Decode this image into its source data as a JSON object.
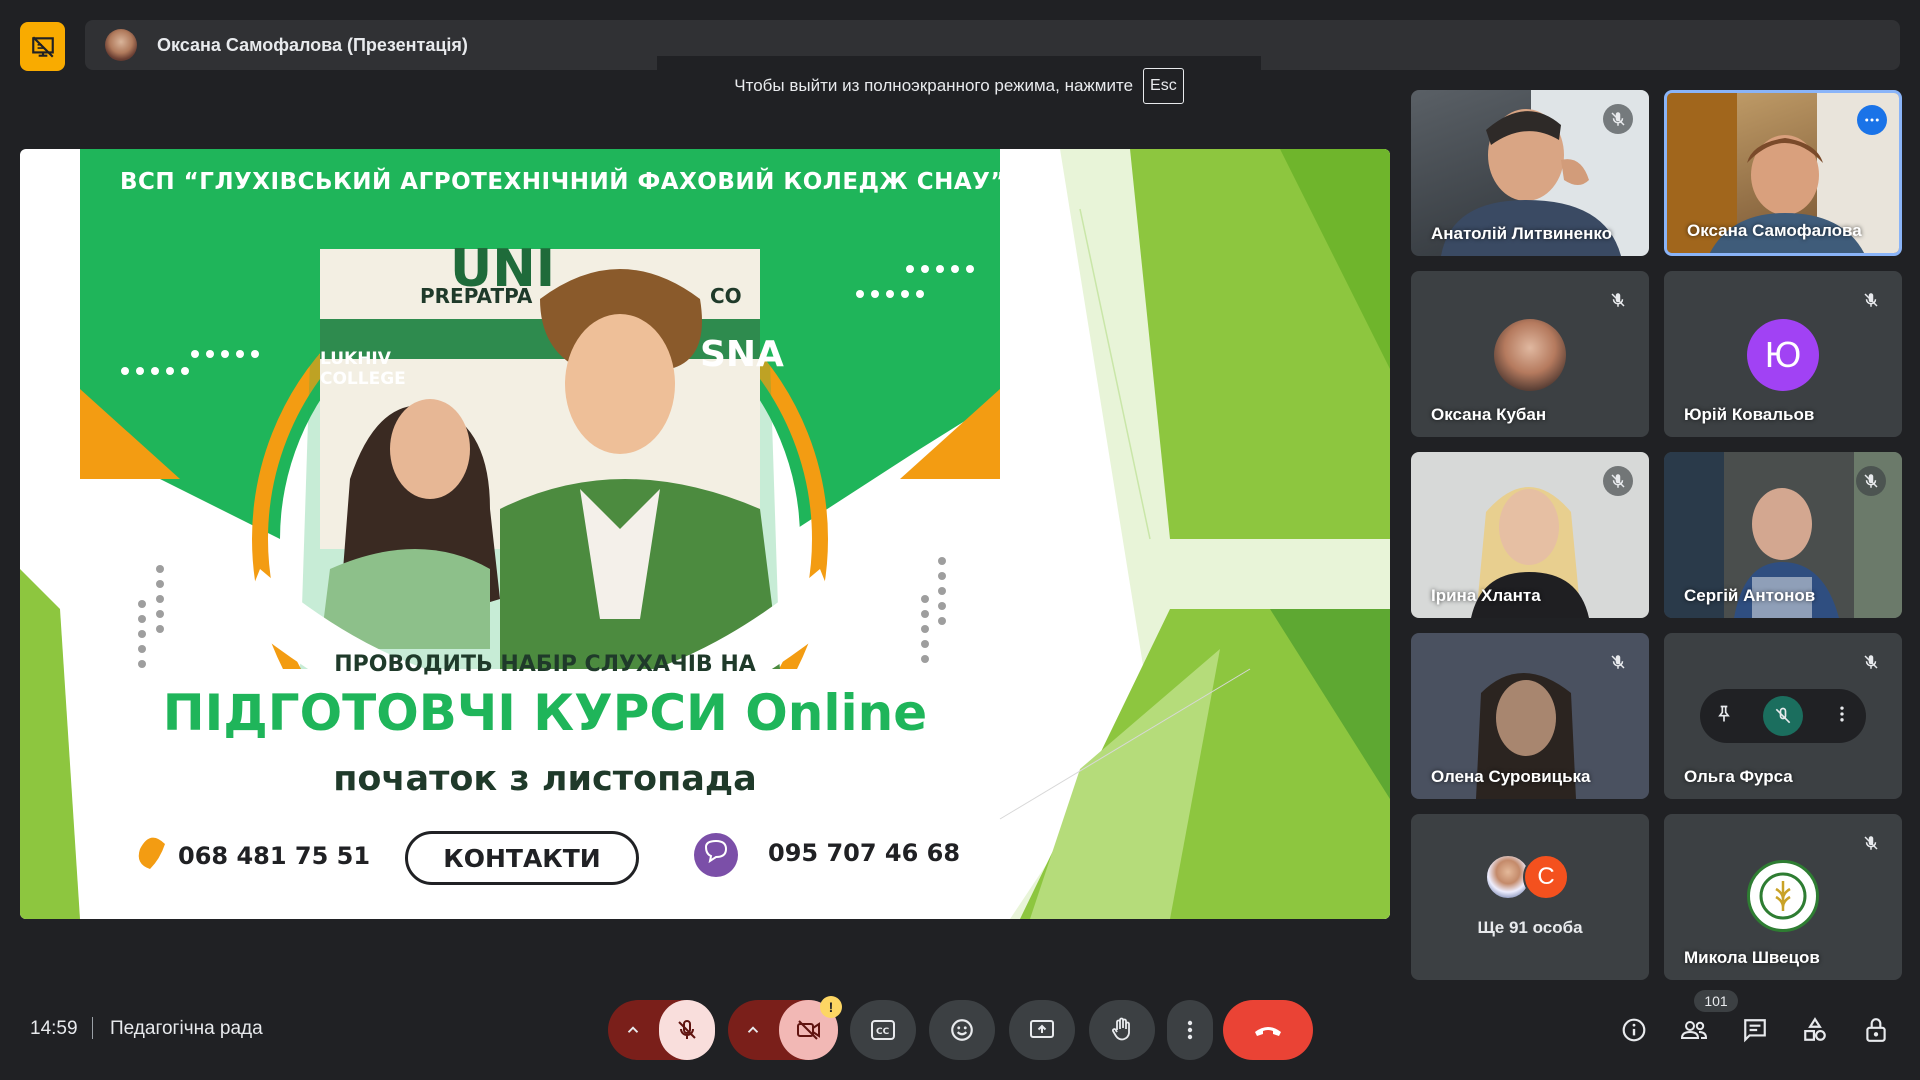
{
  "presentation": {
    "presenter_label": "Оксана Самофалова (Презентація)",
    "fullscreen_notice": "Чтобы выйти из полноэкранного режима, нажмите",
    "esc_key": "Esc"
  },
  "slide": {
    "header": "ВСП “ГЛУХІВСЬКИЙ АГРОТЕХНІЧНИЙ ФАХОВИЙ КОЛЕДЖ  СНАУ”",
    "sign_top": "UNI",
    "sign_prep": "PREPATPA",
    "sign_co": "CO",
    "sign_college": "LUKHIV COLLEGE",
    "sign_sna": "SNA",
    "subtitle": "ПРОВОДИТЬ НАБІР СЛУХАЧІВ НА",
    "main_title": "ПІДГОТОВЧІ КУРСИ Online",
    "start": "початок з листопада",
    "phone1": "068 481 75 51",
    "contacts_button": "КОНТАКТИ",
    "phone2": "095 707 46 68",
    "colors": {
      "green": "#1fb55a",
      "orange": "#f39c12",
      "lime": "#8dc63f",
      "dark": "#1f3a2a"
    }
  },
  "participants": [
    {
      "name": "Анатолій Литвиненко",
      "muted": true,
      "type": "video"
    },
    {
      "name": "Оксана Самофалова",
      "muted": false,
      "type": "video",
      "active_speaker": true,
      "more_icon": "more-horizontal-icon"
    },
    {
      "name": "Оксана Кубан",
      "muted": true,
      "type": "photo-avatar"
    },
    {
      "name": "Юрій Ковальов",
      "muted": true,
      "type": "letter-avatar",
      "initial": "Ю",
      "avatar_color": "#a142f4"
    },
    {
      "name": "Ірина Хланта",
      "muted": true,
      "type": "video"
    },
    {
      "name": "Сергій Антонов",
      "muted": true,
      "type": "video"
    },
    {
      "name": "Олена Суровицька",
      "muted": true,
      "type": "video"
    },
    {
      "name": "Ольга Фурса",
      "muted": true,
      "type": "hover-controls"
    },
    {
      "label": "Ще 91 особа",
      "type": "overflow",
      "extra_initial": "С",
      "extra_color": "#f4511e"
    },
    {
      "name": "Микола Швецов",
      "muted": true,
      "type": "logo-avatar"
    }
  ],
  "bottom": {
    "time": "14:59",
    "meeting_title": "Педагогічна рада",
    "people_count": "101",
    "controls": [
      "chevron-up-icon",
      "mic-off-icon",
      "chevron-up-icon",
      "camera-off-icon",
      "captions-icon",
      "emoji-icon",
      "present-icon",
      "raise-hand-icon",
      "more-vertical-icon",
      "end-call-icon"
    ],
    "right_icons": [
      "info-icon",
      "people-icon",
      "chat-icon",
      "activities-icon",
      "host-controls-icon"
    ],
    "colors": {
      "red": "#ea4335",
      "dark_red": "#7a1f1a",
      "pink": "#f9dedc",
      "warning": "#fdd663"
    }
  }
}
